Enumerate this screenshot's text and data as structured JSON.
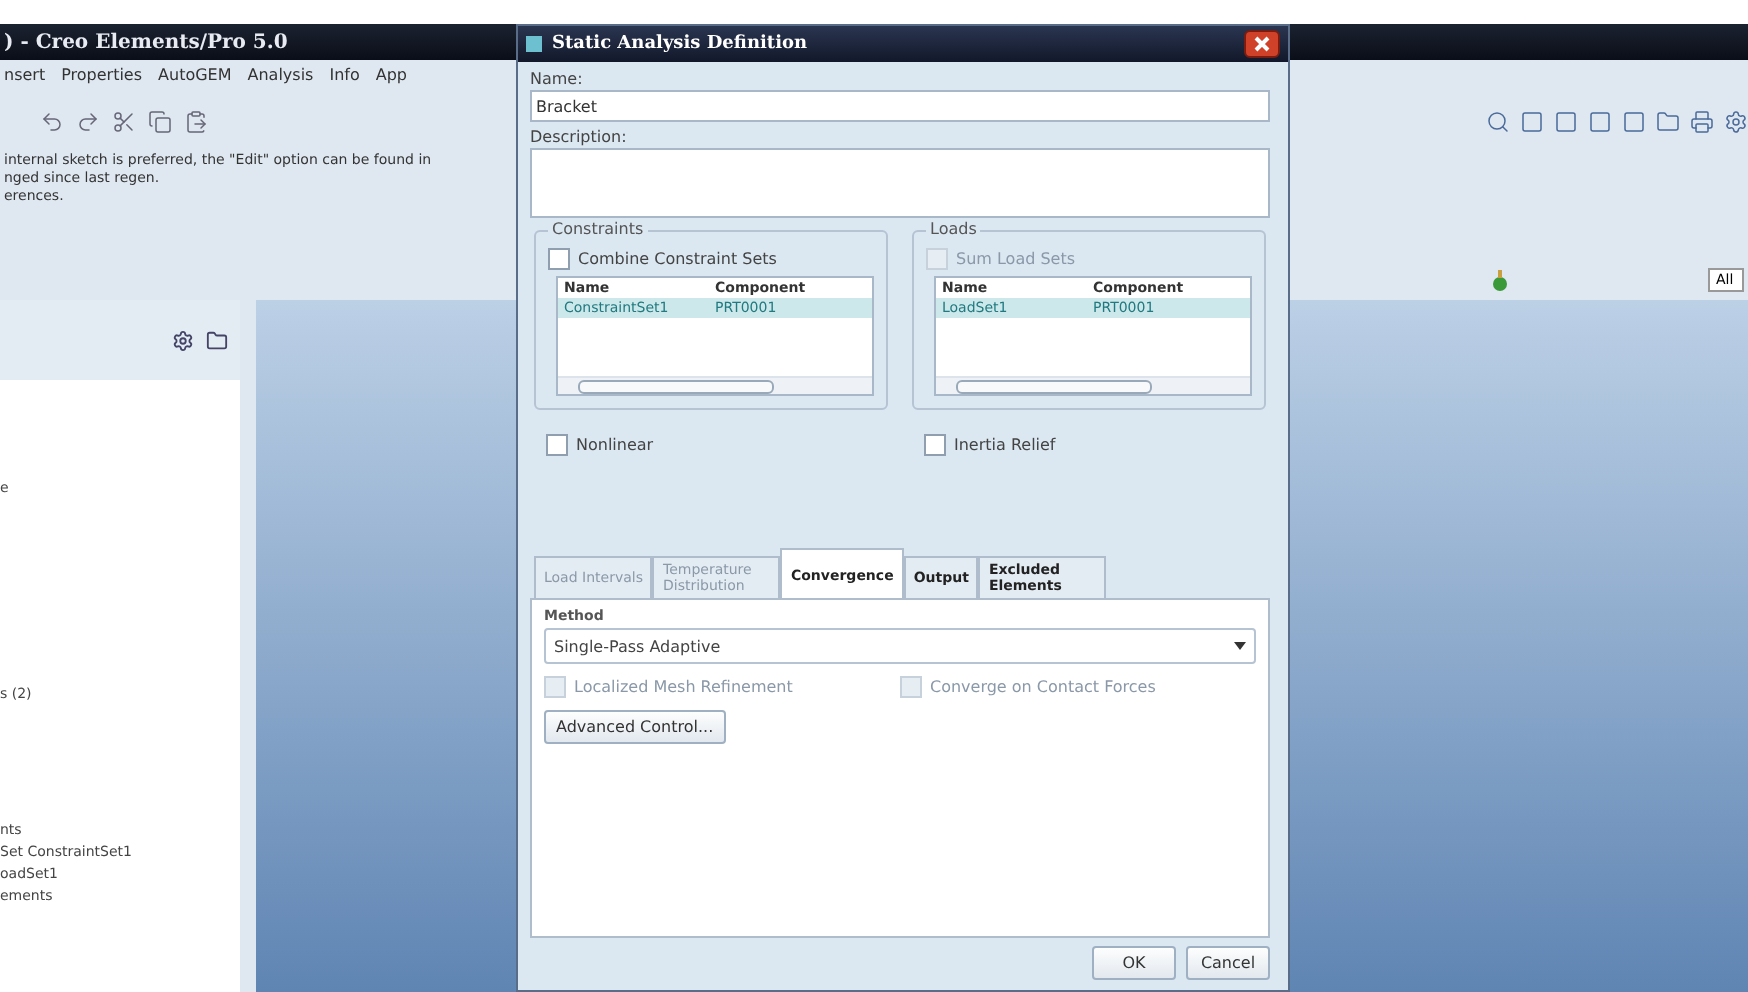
{
  "app": {
    "title": ") - Creo Elements/Pro 5.0",
    "menu": [
      {
        "label": "nsert"
      },
      {
        "label": "Properties"
      },
      {
        "label": "AutoGEM"
      },
      {
        "label": "Analysis"
      },
      {
        "label": "Info"
      },
      {
        "label": "App"
      }
    ],
    "messages": [
      "internal sketch is preferred, the \"Edit\" option can be found in",
      "nged since last regen.",
      "erences."
    ],
    "tree_items": [
      "e",
      "s (2)",
      "nts",
      "Set ConstraintSet1",
      "oadSet1",
      "ements"
    ],
    "filter_field": "All"
  },
  "dialog": {
    "title": "Static Analysis Definition",
    "name_label": "Name:",
    "name_value": "Bracket",
    "description_label": "Description:",
    "groups": [
      {
        "title": "Constraints",
        "option": {
          "label": "Combine Constraint Sets",
          "checked": false,
          "disabled": false
        },
        "columns": [
          "Name",
          "Component"
        ],
        "rows": [
          {
            "cells": [
              "ConstraintSet1",
              "PRT0001"
            ],
            "selected": true
          }
        ],
        "below": {
          "label": "Nonlinear",
          "checked": false,
          "disabled": false
        }
      },
      {
        "title": "Loads",
        "option": {
          "label": "Sum Load Sets",
          "checked": false,
          "disabled": true
        },
        "columns": [
          "Name",
          "Component"
        ],
        "rows": [
          {
            "cells": [
              "LoadSet1",
              "PRT0001"
            ],
            "selected": true
          }
        ],
        "below": {
          "label": "Inertia Relief",
          "checked": false,
          "disabled": false
        }
      }
    ],
    "tabs": [
      {
        "label": "Load Intervals",
        "selected": false,
        "disabled": true
      },
      {
        "label": "Temperature Distribution",
        "selected": false,
        "disabled": true
      },
      {
        "label": "Convergence",
        "selected": true,
        "disabled": false
      },
      {
        "label": "Output",
        "selected": false,
        "disabled": false
      },
      {
        "label": "Excluded Elements",
        "selected": false,
        "disabled": false
      }
    ],
    "method_label": "Method",
    "method_value": "Single-Pass Adaptive",
    "options": [
      {
        "label": "Localized Mesh Refinement",
        "checked": false,
        "disabled": true
      },
      {
        "label": "Converge on Contact Forces",
        "checked": false,
        "disabled": true
      }
    ],
    "advanced_button": "Advanced Control...",
    "buttons": [
      "OK",
      "Cancel"
    ]
  }
}
